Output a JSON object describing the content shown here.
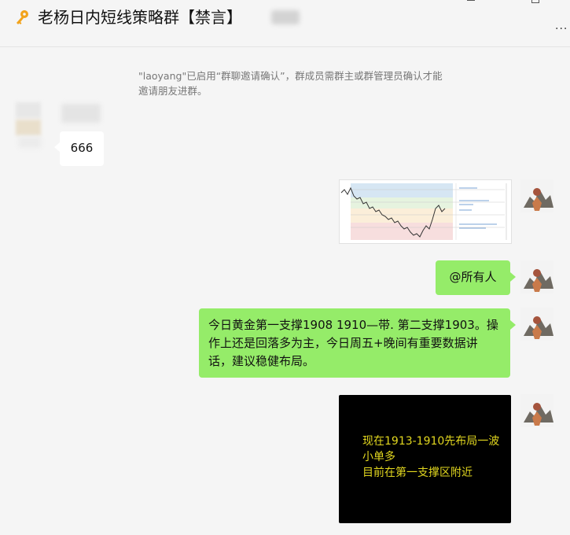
{
  "header": {
    "title": "老杨日内短线策略群【禁言】",
    "more_label": "..."
  },
  "system_message": {
    "text": "\"laoyang\"已启用“群聊邀请确认”，群成员需群主或群管理员确认才能邀请朋友进群。"
  },
  "messages": {
    "m1": {
      "text": "666"
    },
    "m3": {
      "text": "@所有人"
    },
    "m4": {
      "text": "今日黄金第一支撑1908 1910—带. 第二支撑1903。操作上还是回落多为主，今日周五+晚间有重要数据讲话，建议稳健布局。"
    },
    "m5": {
      "line1": "现在1913-1910先布局一波",
      "line2": "小单多",
      "line3": "目前在第一支撑区附近"
    }
  },
  "colors": {
    "bubble_green": "#95ec69",
    "overlay_text": "#e2d71f",
    "key_icon": "#f2a31c"
  },
  "icons": [
    "key-icon",
    "minimize-icon",
    "maximize-icon",
    "more-icon"
  ]
}
